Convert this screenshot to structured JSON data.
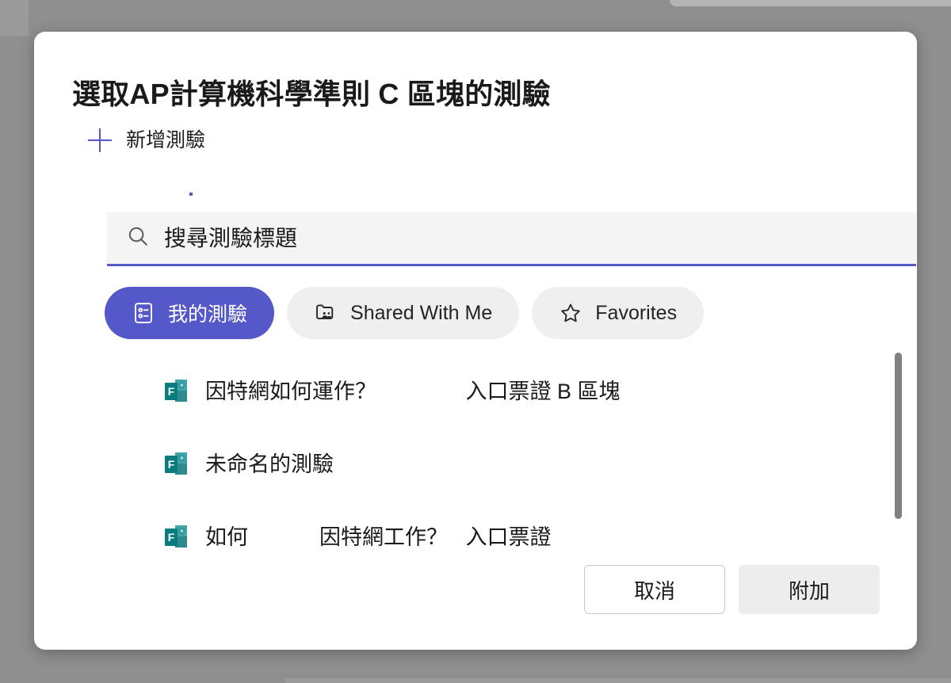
{
  "colors": {
    "accent_purple": "#5558c8",
    "forms_teal": "#0b6a68",
    "forms_teal_light": "#41a5ab",
    "overlay_gray": "#8f8f8f",
    "tab_inactive_bg": "#efefef",
    "search_bg": "#f4f4f4",
    "attach_bg": "#ededed",
    "scrollbar": "#808080"
  },
  "dialog": {
    "title": "選取AP計算機科學準則 C 區塊的測驗",
    "add_quiz": {
      "label": "新增測驗",
      "icon": "plus-icon"
    },
    "search": {
      "placeholder": "搜尋測驗標題",
      "value": "",
      "icon": "search-icon"
    },
    "tabs": [
      {
        "label": "我的測驗",
        "icon": "forms-list-icon",
        "active": true
      },
      {
        "label": "Shared With Me",
        "icon": "shared-folder-icon",
        "active": false
      },
      {
        "label": "Favorites",
        "icon": "star-icon",
        "active": false
      }
    ],
    "quiz_list": [
      {
        "title": "因特網如何運作？               入口票證 B 區塊",
        "icon": "microsoft-forms-icon"
      },
      {
        "title": "未命名的測驗",
        "icon": "microsoft-forms-icon"
      },
      {
        "title": "如何            因特網工作？   入口票證",
        "icon": "microsoft-forms-icon"
      }
    ],
    "scrollbar": {
      "visible": true
    },
    "footer": {
      "cancel_label": "取消",
      "attach_label": "附加"
    }
  }
}
